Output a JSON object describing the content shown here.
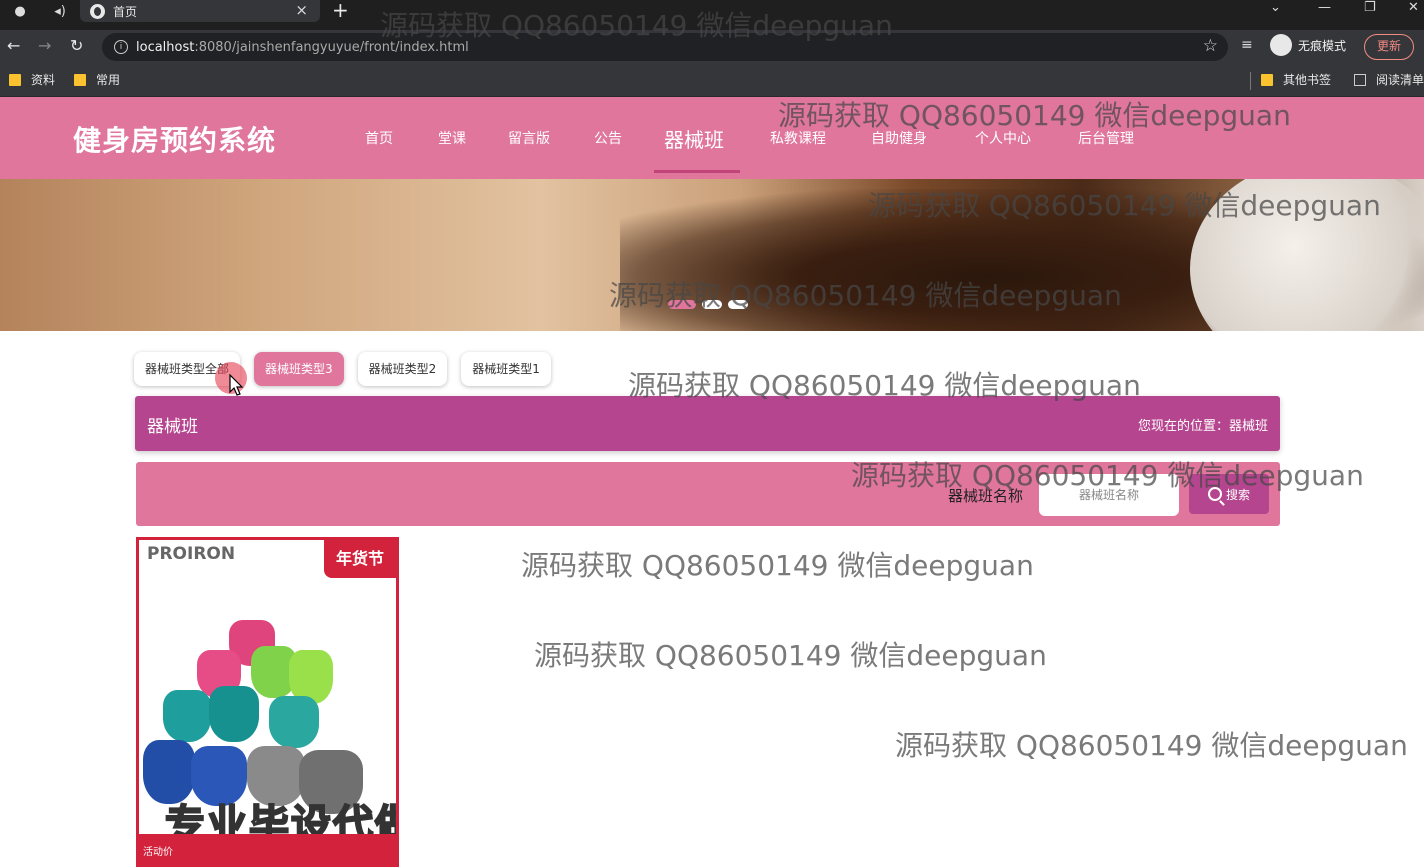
{
  "browser": {
    "tab_title": "首页",
    "url_host": "localhost",
    "url_rest": ":8080/jainshenfangyuyue/front/index.html",
    "incognito_label": "无痕模式",
    "update_label": "更新",
    "bookmarks": [
      "资料",
      "常用"
    ],
    "bookmarks_right": [
      "其他书签",
      "阅读清单"
    ]
  },
  "site": {
    "title": "健身房预约系统",
    "menu": [
      {
        "label": "首页"
      },
      {
        "label": "堂课"
      },
      {
        "label": "留言版"
      },
      {
        "label": "公告"
      },
      {
        "label": "器械班",
        "active": true
      },
      {
        "label": "私教课程"
      },
      {
        "label": "自助健身"
      },
      {
        "label": "个人中心"
      },
      {
        "label": "后台管理"
      }
    ]
  },
  "banner": {
    "slides": 3,
    "active_slide": 1
  },
  "filters": [
    {
      "label": "器械班类型全部"
    },
    {
      "label": "器械班类型3",
      "active": true
    },
    {
      "label": "器械班类型2"
    },
    {
      "label": "器械班类型1"
    }
  ],
  "section": {
    "title": "器械班",
    "location": "您现在的位置：器械班"
  },
  "search": {
    "label": "器械班名称",
    "placeholder": "器械班名称",
    "button": "搜索"
  },
  "product": {
    "brand": "PROIRON",
    "promo": "年货节",
    "overlay": "专业毕设代做",
    "price_label": "活动价"
  },
  "watermark": "源码获取 QQ86050149 微信deepguan",
  "colors": {
    "header": "#e0769c",
    "title_bar": "#b6458f",
    "product_border": "#d2223c"
  }
}
